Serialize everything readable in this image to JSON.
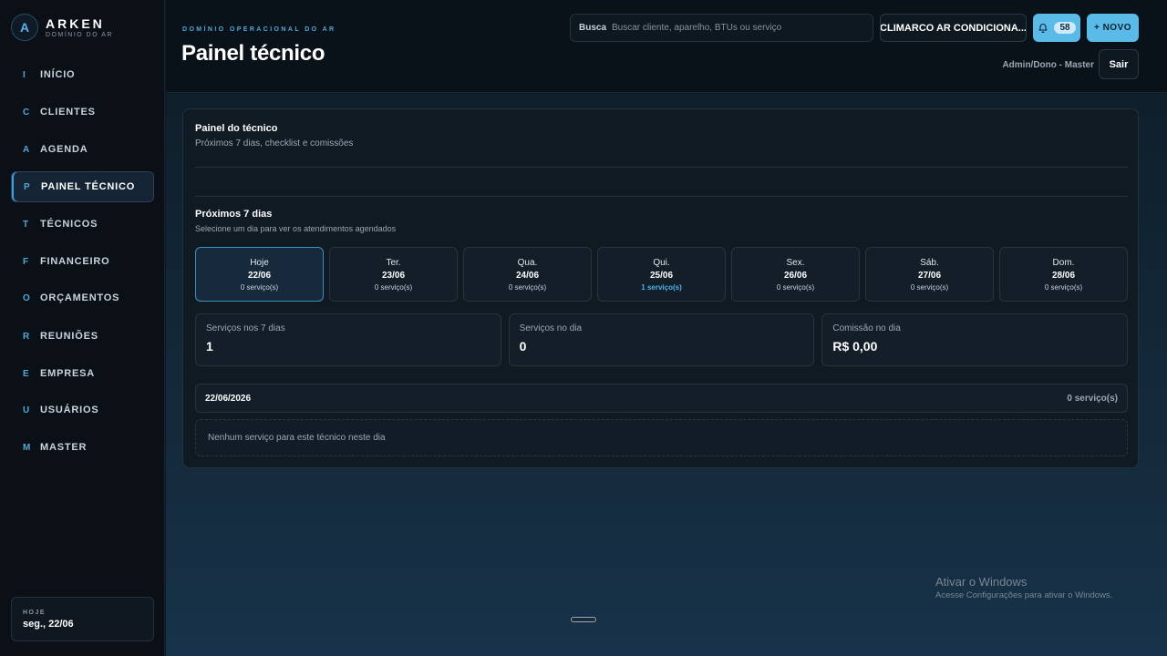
{
  "brand": {
    "logo": "A",
    "name": "ARKEN",
    "subtitle": "DOMÍNIO DO AR"
  },
  "sidebar": {
    "items": [
      {
        "letter": "I",
        "label": "INÍCIO"
      },
      {
        "letter": "C",
        "label": "CLIENTES"
      },
      {
        "letter": "A",
        "label": "AGENDA"
      },
      {
        "letter": "P",
        "label": "PAINEL TÉCNICO",
        "active": true
      },
      {
        "letter": "T",
        "label": "TÉCNICOS"
      },
      {
        "letter": "F",
        "label": "FINANCEIRO"
      },
      {
        "letter": "O",
        "label": "ORÇAMENTOS"
      },
      {
        "letter": "R",
        "label": "REUNIÕES"
      },
      {
        "letter": "E",
        "label": "EMPRESA"
      },
      {
        "letter": "U",
        "label": "USUÁRIOS"
      },
      {
        "letter": "M",
        "label": "MASTER"
      }
    ],
    "today": {
      "label": "HOJE",
      "value": "seg., 22/06"
    }
  },
  "header": {
    "eyebrow": "DOMÍNIO OPERACIONAL DO AR",
    "title": "Painel técnico",
    "search": {
      "label": "Busca",
      "placeholder": "Buscar cliente, aparelho, BTUs ou serviço",
      "value": ""
    },
    "company": "CLIMARCO AR CONDICIONA...",
    "notifications": "58",
    "new_label": "+ NOVO",
    "user": "Admin/Dono - Master",
    "logout": "Sair"
  },
  "panel": {
    "title": "Painel do técnico",
    "subtitle": "Próximos 7 dias, checklist e comissões",
    "week": {
      "title": "Próximos 7 dias",
      "subtitle": "Selecione um dia para ver os atendimentos agendados",
      "days": [
        {
          "name": "Hoje",
          "date": "22/06",
          "count": "0 serviço(s)",
          "selected": true
        },
        {
          "name": "Ter.",
          "date": "23/06",
          "count": "0 serviço(s)"
        },
        {
          "name": "Qua.",
          "date": "24/06",
          "count": "0 serviço(s)"
        },
        {
          "name": "Qui.",
          "date": "25/06",
          "count": "1 serviço(s)",
          "has_services": true
        },
        {
          "name": "Sex.",
          "date": "26/06",
          "count": "0 serviço(s)"
        },
        {
          "name": "Sáb.",
          "date": "27/06",
          "count": "0 serviço(s)"
        },
        {
          "name": "Dom.",
          "date": "28/06",
          "count": "0 serviço(s)"
        }
      ]
    },
    "stats": [
      {
        "label": "Serviços nos 7 dias",
        "value": "1"
      },
      {
        "label": "Serviços no dia",
        "value": "0"
      },
      {
        "label": "Comissão no dia",
        "value": "R$ 0,00"
      }
    ],
    "selected_day": {
      "date": "22/06/2026",
      "count": "0 serviço(s)"
    },
    "empty_message": "Nenhum serviço para este técnico neste dia"
  },
  "watermark": {
    "title": "Ativar o Windows",
    "subtitle": "Acesse Configurações para ativar o Windows."
  },
  "colors": {
    "accent": "#5bbbe8",
    "highlight": "#4fb2ea",
    "background": "#0d1822"
  },
  "icons": {
    "notifications": "bell-icon"
  }
}
